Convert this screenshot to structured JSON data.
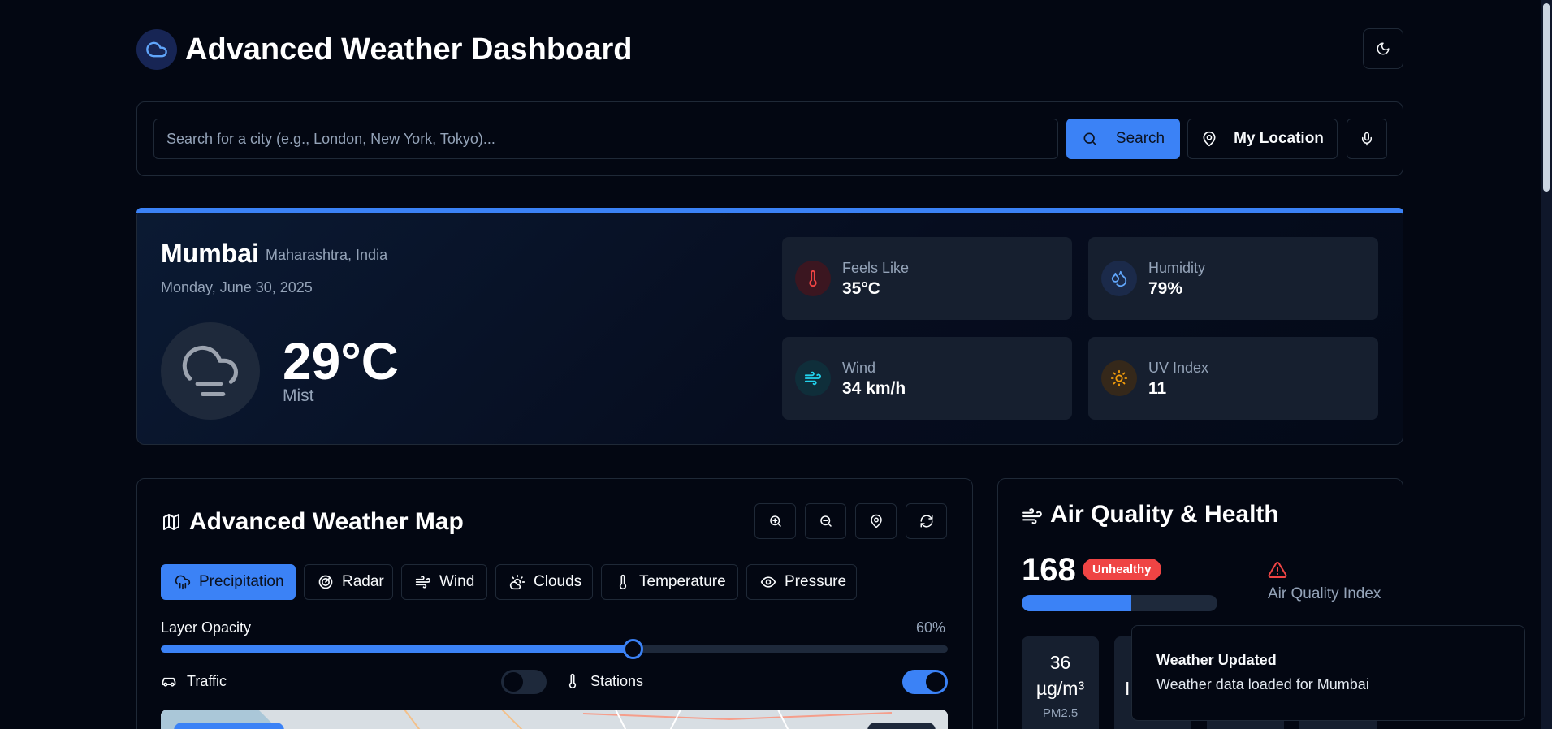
{
  "header": {
    "title": "Advanced Weather Dashboard",
    "logo_icon": "cloud-icon",
    "theme_icon": "moon-icon"
  },
  "search": {
    "placeholder": "Search for a city (e.g., London, New York, Tokyo)...",
    "value": "",
    "search_label": "Search",
    "location_label": "My Location"
  },
  "current": {
    "city": "Mumbai",
    "region": "Maharashtra, India",
    "date": "Monday, June 30, 2025",
    "temperature": "29°C",
    "condition": "Mist",
    "condition_icon": "mist-cloud-icon",
    "stats": [
      {
        "label": "Feels Like",
        "value": "35°C",
        "icon": "thermometer-icon",
        "color": "#ef4444"
      },
      {
        "label": "Humidity",
        "value": "79%",
        "icon": "droplets-icon",
        "color": "#60a5fa"
      },
      {
        "label": "Wind",
        "value": "34 km/h",
        "icon": "wind-icon",
        "color": "#22d3ee"
      },
      {
        "label": "UV Index",
        "value": "11",
        "icon": "sun-icon",
        "color": "#f59e0b"
      }
    ]
  },
  "map": {
    "title": "Advanced Weather Map",
    "layers": [
      "Precipitation",
      "Radar",
      "Wind",
      "Clouds",
      "Temperature",
      "Pressure"
    ],
    "active_layer": "Precipitation",
    "opacity_label": "Layer Opacity",
    "opacity_value": "60%",
    "opacity_fraction": 0.6,
    "traffic_label": "Traffic",
    "traffic_on": false,
    "stations_label": "Stations",
    "stations_on": true
  },
  "air": {
    "title": "Air Quality & Health",
    "aqi": "168",
    "status": "Unhealthy",
    "index_label": "Air Quality Index",
    "aqi_bar_fraction": 0.56,
    "pm25_value": "36",
    "pm25_unit": "µg/m³",
    "pm25_label": "PM2.5",
    "pm10_value_partial": "I"
  },
  "toast": {
    "title": "Weather Updated",
    "message": "Weather data loaded for Mumbai"
  },
  "colors": {
    "accent": "#3b82f6",
    "background": "#030712",
    "danger": "#ef4444",
    "tile": "#161f2f"
  }
}
